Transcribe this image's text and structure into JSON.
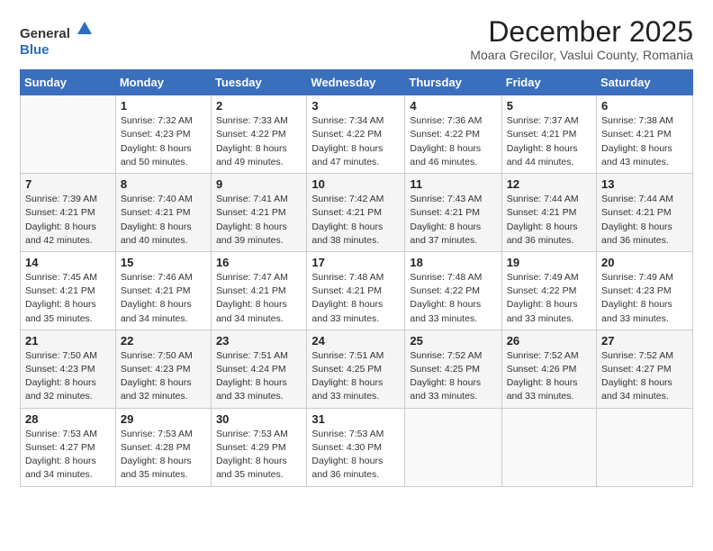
{
  "logo": {
    "general": "General",
    "blue": "Blue"
  },
  "title": "December 2025",
  "subtitle": "Moara Grecilor, Vaslui County, Romania",
  "days_of_week": [
    "Sunday",
    "Monday",
    "Tuesday",
    "Wednesday",
    "Thursday",
    "Friday",
    "Saturday"
  ],
  "weeks": [
    [
      {
        "day": "",
        "detail": ""
      },
      {
        "day": "1",
        "detail": "Sunrise: 7:32 AM\nSunset: 4:23 PM\nDaylight: 8 hours\nand 50 minutes."
      },
      {
        "day": "2",
        "detail": "Sunrise: 7:33 AM\nSunset: 4:22 PM\nDaylight: 8 hours\nand 49 minutes."
      },
      {
        "day": "3",
        "detail": "Sunrise: 7:34 AM\nSunset: 4:22 PM\nDaylight: 8 hours\nand 47 minutes."
      },
      {
        "day": "4",
        "detail": "Sunrise: 7:36 AM\nSunset: 4:22 PM\nDaylight: 8 hours\nand 46 minutes."
      },
      {
        "day": "5",
        "detail": "Sunrise: 7:37 AM\nSunset: 4:21 PM\nDaylight: 8 hours\nand 44 minutes."
      },
      {
        "day": "6",
        "detail": "Sunrise: 7:38 AM\nSunset: 4:21 PM\nDaylight: 8 hours\nand 43 minutes."
      }
    ],
    [
      {
        "day": "7",
        "detail": "Sunrise: 7:39 AM\nSunset: 4:21 PM\nDaylight: 8 hours\nand 42 minutes."
      },
      {
        "day": "8",
        "detail": "Sunrise: 7:40 AM\nSunset: 4:21 PM\nDaylight: 8 hours\nand 40 minutes."
      },
      {
        "day": "9",
        "detail": "Sunrise: 7:41 AM\nSunset: 4:21 PM\nDaylight: 8 hours\nand 39 minutes."
      },
      {
        "day": "10",
        "detail": "Sunrise: 7:42 AM\nSunset: 4:21 PM\nDaylight: 8 hours\nand 38 minutes."
      },
      {
        "day": "11",
        "detail": "Sunrise: 7:43 AM\nSunset: 4:21 PM\nDaylight: 8 hours\nand 37 minutes."
      },
      {
        "day": "12",
        "detail": "Sunrise: 7:44 AM\nSunset: 4:21 PM\nDaylight: 8 hours\nand 36 minutes."
      },
      {
        "day": "13",
        "detail": "Sunrise: 7:44 AM\nSunset: 4:21 PM\nDaylight: 8 hours\nand 36 minutes."
      }
    ],
    [
      {
        "day": "14",
        "detail": "Sunrise: 7:45 AM\nSunset: 4:21 PM\nDaylight: 8 hours\nand 35 minutes."
      },
      {
        "day": "15",
        "detail": "Sunrise: 7:46 AM\nSunset: 4:21 PM\nDaylight: 8 hours\nand 34 minutes."
      },
      {
        "day": "16",
        "detail": "Sunrise: 7:47 AM\nSunset: 4:21 PM\nDaylight: 8 hours\nand 34 minutes."
      },
      {
        "day": "17",
        "detail": "Sunrise: 7:48 AM\nSunset: 4:21 PM\nDaylight: 8 hours\nand 33 minutes."
      },
      {
        "day": "18",
        "detail": "Sunrise: 7:48 AM\nSunset: 4:22 PM\nDaylight: 8 hours\nand 33 minutes."
      },
      {
        "day": "19",
        "detail": "Sunrise: 7:49 AM\nSunset: 4:22 PM\nDaylight: 8 hours\nand 33 minutes."
      },
      {
        "day": "20",
        "detail": "Sunrise: 7:49 AM\nSunset: 4:23 PM\nDaylight: 8 hours\nand 33 minutes."
      }
    ],
    [
      {
        "day": "21",
        "detail": "Sunrise: 7:50 AM\nSunset: 4:23 PM\nDaylight: 8 hours\nand 32 minutes."
      },
      {
        "day": "22",
        "detail": "Sunrise: 7:50 AM\nSunset: 4:23 PM\nDaylight: 8 hours\nand 32 minutes."
      },
      {
        "day": "23",
        "detail": "Sunrise: 7:51 AM\nSunset: 4:24 PM\nDaylight: 8 hours\nand 33 minutes."
      },
      {
        "day": "24",
        "detail": "Sunrise: 7:51 AM\nSunset: 4:25 PM\nDaylight: 8 hours\nand 33 minutes."
      },
      {
        "day": "25",
        "detail": "Sunrise: 7:52 AM\nSunset: 4:25 PM\nDaylight: 8 hours\nand 33 minutes."
      },
      {
        "day": "26",
        "detail": "Sunrise: 7:52 AM\nSunset: 4:26 PM\nDaylight: 8 hours\nand 33 minutes."
      },
      {
        "day": "27",
        "detail": "Sunrise: 7:52 AM\nSunset: 4:27 PM\nDaylight: 8 hours\nand 34 minutes."
      }
    ],
    [
      {
        "day": "28",
        "detail": "Sunrise: 7:53 AM\nSunset: 4:27 PM\nDaylight: 8 hours\nand 34 minutes."
      },
      {
        "day": "29",
        "detail": "Sunrise: 7:53 AM\nSunset: 4:28 PM\nDaylight: 8 hours\nand 35 minutes."
      },
      {
        "day": "30",
        "detail": "Sunrise: 7:53 AM\nSunset: 4:29 PM\nDaylight: 8 hours\nand 35 minutes."
      },
      {
        "day": "31",
        "detail": "Sunrise: 7:53 AM\nSunset: 4:30 PM\nDaylight: 8 hours\nand 36 minutes."
      },
      {
        "day": "",
        "detail": ""
      },
      {
        "day": "",
        "detail": ""
      },
      {
        "day": "",
        "detail": ""
      }
    ]
  ]
}
